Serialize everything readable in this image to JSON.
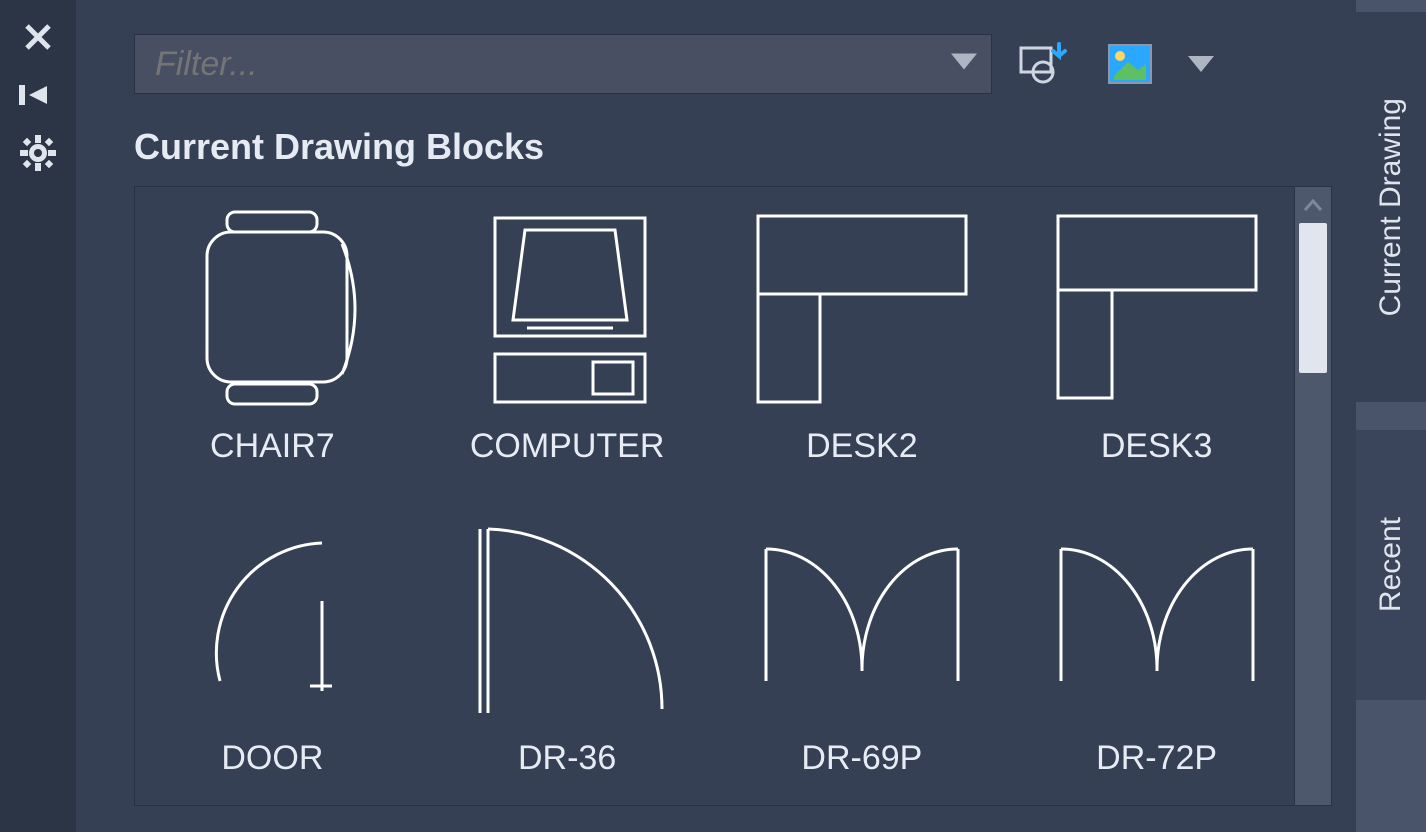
{
  "filter": {
    "placeholder": "Filter..."
  },
  "section_title": "Current Drawing Blocks",
  "tabs": {
    "active": "Current Drawing",
    "inactive": "Recent"
  },
  "blocks": [
    {
      "name": "CHAIR7"
    },
    {
      "name": "COMPUTER"
    },
    {
      "name": "DESK2"
    },
    {
      "name": "DESK3"
    },
    {
      "name": "DOOR"
    },
    {
      "name": "DR-36"
    },
    {
      "name": "DR-69P"
    },
    {
      "name": "DR-72P"
    }
  ],
  "icons": {
    "close": "close-icon",
    "pin": "pin-icon",
    "settings": "gear-icon",
    "insert": "insert-block-icon",
    "thumb_view": "thumbnail-view-icon",
    "dd": "chevron-down-icon",
    "scroll_up": "chevron-up-icon"
  }
}
